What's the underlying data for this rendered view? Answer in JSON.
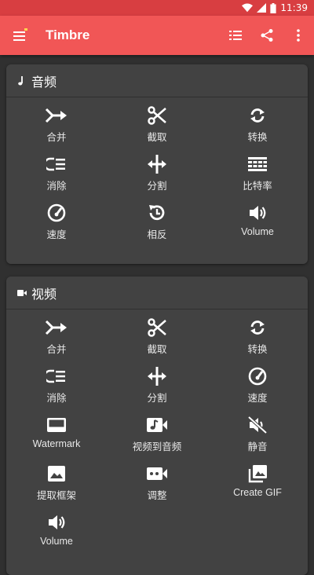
{
  "status": {
    "time": "11:39"
  },
  "appbar": {
    "title": "Timbre"
  },
  "audio": {
    "title": "音频",
    "items": [
      {
        "label": "合并",
        "icon": "merge-icon"
      },
      {
        "label": "截取",
        "icon": "scissors-icon"
      },
      {
        "label": "转换",
        "icon": "convert-icon"
      },
      {
        "label": "消除",
        "icon": "remove-icon"
      },
      {
        "label": "分割",
        "icon": "split-icon"
      },
      {
        "label": "比特率",
        "icon": "bitrate-icon"
      },
      {
        "label": "速度",
        "icon": "speedometer-icon"
      },
      {
        "label": "相反",
        "icon": "reverse-icon"
      },
      {
        "label": "Volume",
        "icon": "volume-icon"
      }
    ]
  },
  "video": {
    "title": "视频",
    "items": [
      {
        "label": "合并",
        "icon": "merge-icon"
      },
      {
        "label": "截取",
        "icon": "scissors-icon"
      },
      {
        "label": "转换",
        "icon": "convert-icon"
      },
      {
        "label": "消除",
        "icon": "remove-icon"
      },
      {
        "label": "分割",
        "icon": "split-icon"
      },
      {
        "label": "速度",
        "icon": "speedometer-icon"
      },
      {
        "label": "Watermark",
        "icon": "watermark-icon"
      },
      {
        "label": "视频到音频",
        "icon": "video-to-audio-icon"
      },
      {
        "label": "静音",
        "icon": "mute-icon"
      },
      {
        "label": "提取框架",
        "icon": "image-icon"
      },
      {
        "label": "调整",
        "icon": "video-camera-icon"
      },
      {
        "label": "Create GIF",
        "icon": "gif-library-icon"
      },
      {
        "label": "Volume",
        "icon": "volume-icon"
      }
    ]
  },
  "colors": {
    "appbar": "#f15656",
    "statusbar": "#d83e41",
    "background": "#303030",
    "card": "#424242"
  }
}
